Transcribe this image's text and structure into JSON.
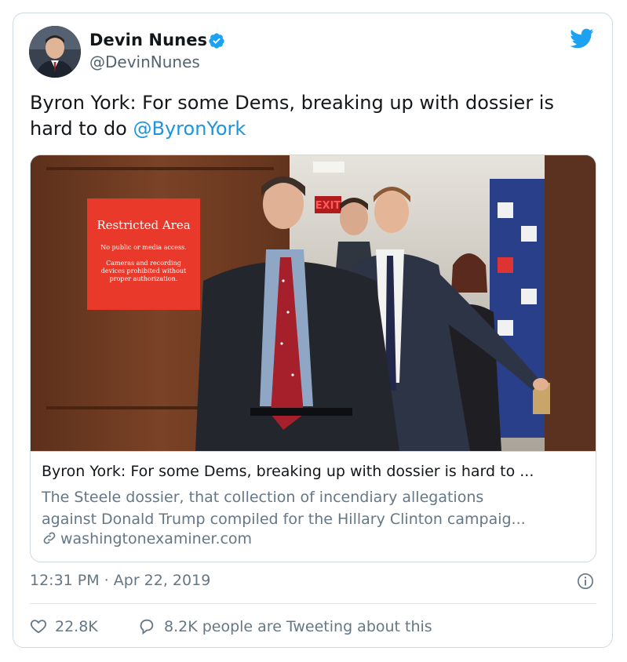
{
  "author": {
    "name": "Devin Nunes",
    "handle": "@DevinNunes",
    "verified_color": "#1da1f2"
  },
  "icons": {
    "brand": "twitter-bird-icon",
    "verified": "verified-badge-icon",
    "info": "info-icon",
    "like": "heart-icon",
    "reply": "speech-bubble-icon",
    "link": "link-icon"
  },
  "tweet": {
    "text": "Byron York: For some Dems, breaking up with dossier is hard to do ",
    "mention": "@ByronYork"
  },
  "link_card": {
    "image_sign": {
      "title": "Restricted Area",
      "line1": "No public or media access.",
      "line2": "Cameras and recording",
      "line3": "devices prohibited without",
      "line4": "proper authorization."
    },
    "exit_sign": "EXIT",
    "title": "Byron York: For some Dems, breaking up with dossier is hard to ...",
    "description_line1": "The Steele dossier, that collection of incendiary allegations",
    "description_line2": "against Donald Trump compiled for the Hillary Clinton campaig...",
    "domain": "washingtonexaminer.com"
  },
  "timestamp": "12:31 PM · Apr 22, 2019",
  "engagement": {
    "likes": "22.8K",
    "replies_text": "8.2K people are Tweeting about this"
  },
  "colors": {
    "accent": "#1da1f2",
    "mention": "#1b95e0",
    "muted": "#657786",
    "sign_red": "#e8392b"
  }
}
